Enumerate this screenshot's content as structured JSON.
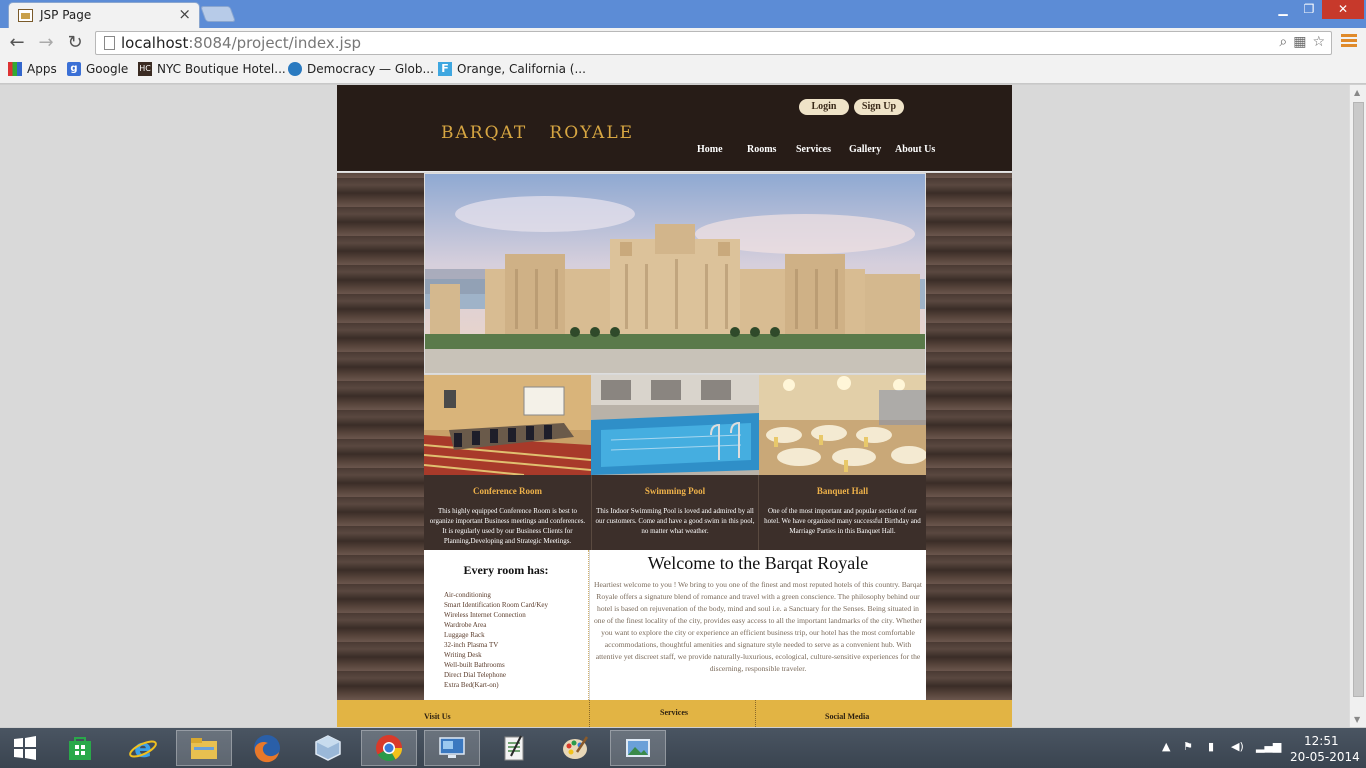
{
  "browser": {
    "tab_title": "JSP Page",
    "url_host": "localhost",
    "url_rest": ":8084/project/index.jsp",
    "bookmarks": [
      "Apps",
      "Google",
      "NYC Boutique Hotel...",
      "Democracy — Glob...",
      "Orange, California (..."
    ]
  },
  "site": {
    "logo": "BARQAT   ROYALE",
    "auth": {
      "login": "Login",
      "signup": "Sign Up"
    },
    "nav": [
      "Home",
      "Rooms",
      "Services",
      "Gallery",
      "About Us"
    ],
    "features": [
      {
        "title": "Conference Room",
        "text": "This highly equipped Conference Room is best to organize important Business meetings and conferences. It is regularly used by our Business Clients for Planning,Developing and Strategic Meetings."
      },
      {
        "title": "Swimming Pool",
        "text": "This Indoor Swimming Pool is loved and admired by all our customers. Come and have a good swim in this pool, no matter what weather."
      },
      {
        "title": "Banquet Hall",
        "text": "One of the most important and popular section of our hotel. We have organized many successful Birthday and Marriage Parties in this Banquet Hall."
      }
    ],
    "rooms": {
      "title": "Every room has:",
      "items": [
        "Air-conditioning",
        "Smart Identification Room Card/Key",
        "Wireless Internet Connection",
        "Wardrobe Area",
        "Luggage Rack",
        "32-inch Plasma TV",
        "Writing Desk",
        "Well-built Bathrooms",
        "Direct Dial Telephone",
        "Extra Bed(Kart-on)"
      ]
    },
    "welcome": {
      "title": "Welcome to the Barqat Royale",
      "text": "Heartiest welcome to you ! We bring to you one of the finest and most reputed hotels of this country. Barqat Royale offers a signature blend of romance and travel with a green conscience. The philosophy behind our hotel is based on rejuvenation of the body, mind and soul i.e. a Sanctuary for the Senses. Being situated in one of the finest locality of the city, provides easy access to all the important landmarks of the city. Whether you want to explore the city or experience an efficient business trip, our hotel has the most comfortable accommodations, thoughtful amenities and signature style needed to serve as a convenient hub. With attentive yet discreet staff, we provide naturally-luxurious, ecological, culture-sensitive experiences for the discerning, responsible traveler."
    },
    "footer": [
      "Visit Us",
      "Services",
      "Social Media"
    ]
  },
  "taskbar": {
    "time": "12:51",
    "date": "20-05-2014"
  },
  "colors": {
    "header": "#271c17",
    "accent": "#d7a642",
    "footer": "#e2b444",
    "feature_title": "#efb24a"
  }
}
